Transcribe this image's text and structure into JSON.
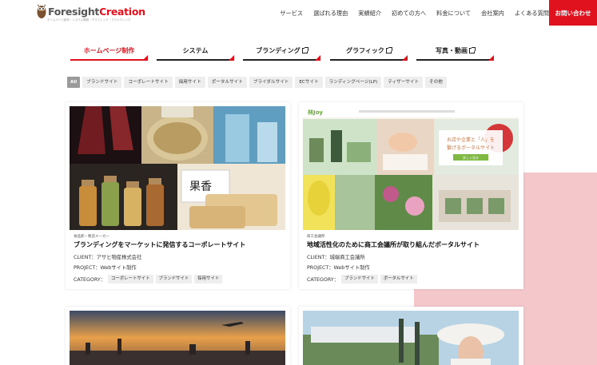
{
  "header": {
    "logo_text_1": "Foresight",
    "logo_text_2": "Creation",
    "logo_sub": "ホームページ制作・システム開発・グラフィック・ブランディング",
    "nav": [
      "サービス",
      "選ばれる理由",
      "実績紹介",
      "初めての方へ",
      "料金について",
      "会社案内",
      "よくある質問"
    ],
    "contact_label": "お問い合わせ"
  },
  "tabs": [
    {
      "label": "ホームページ制作",
      "active": true,
      "external": false
    },
    {
      "label": "システム",
      "active": false,
      "external": false
    },
    {
      "label": "ブランディング",
      "active": false,
      "external": true
    },
    {
      "label": "グラフィック",
      "active": false,
      "external": true
    },
    {
      "label": "写真・動画",
      "active": false,
      "external": true
    }
  ],
  "filters": [
    "All",
    "ブランドサイト",
    "コーポレートサイト",
    "採用サイト",
    "ポータルサイト",
    "ブライダルサイト",
    "ECサイト",
    "ランディングページ(LP)",
    "ティザーサイト",
    "その他"
  ],
  "cards": [
    {
      "meta": "食品卸・製造メーカー",
      "title": "ブランディングをマーケットに発信するコーポレートサイト",
      "client_label": "CLIENT：",
      "client": "アサヒ物産株式会社",
      "project_label": "PROJECT：",
      "project": "Webサイト制作",
      "category_label": "CATEGORY：",
      "categories": [
        "コーポレートサイト",
        "ブランドサイト",
        "採用サイト"
      ],
      "image_jar_label": "果香",
      "colors": {
        "wine": "#7a1e24",
        "gold": "#c9a45a",
        "blue": "#7fb8d6"
      }
    },
    {
      "meta": "商工会議所",
      "title": "地域活性化のために商工会議所が取り組んだポータルサイト",
      "client_label": "CLIENT：",
      "client": "城端商工会議所",
      "project_label": "PROJECT：",
      "project": "Webサイト制作",
      "category_label": "CATEGORY：",
      "categories": [
        "ブランドサイト",
        "ポータルサイト"
      ],
      "overlay_lines": [
        "お店や企業と「人」を",
        "繋げるポータルサイト"
      ],
      "overlay_button": "詳しく見る",
      "site_logo": "林Joy",
      "colors": {
        "green": "#7fb843"
      }
    }
  ],
  "colors": {
    "accent": "#e0121e",
    "pink": "#f4c7cb",
    "chip_bg": "#eeeeee"
  }
}
